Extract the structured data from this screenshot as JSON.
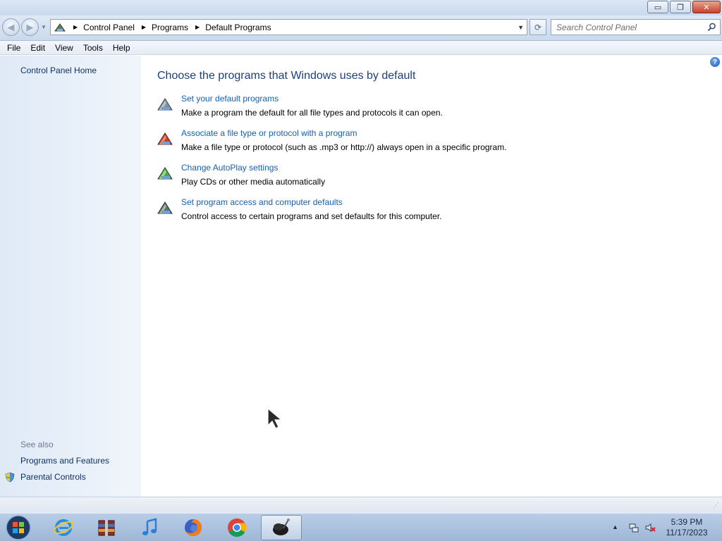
{
  "window": {
    "controls": {
      "minimize": "▭",
      "restore": "❐",
      "close": "✕"
    }
  },
  "nav": {
    "breadcrumbs": [
      "Control Panel",
      "Programs",
      "Default Programs"
    ],
    "search_placeholder": "Search Control Panel"
  },
  "menu": {
    "items": [
      "File",
      "Edit",
      "View",
      "Tools",
      "Help"
    ]
  },
  "sidebar": {
    "home": "Control Panel Home",
    "see_also": "See also",
    "links": [
      "Programs and Features",
      "Parental Controls"
    ]
  },
  "main": {
    "help": "?",
    "heading": "Choose the programs that Windows uses by default",
    "tasks": [
      {
        "link": "Set your default programs",
        "desc": "Make a program the default for all file types and protocols it can open.",
        "icon": "default-programs-icon"
      },
      {
        "link": "Associate a file type or protocol with a program",
        "desc": "Make a file type or protocol (such as .mp3 or http://) always open in a specific program.",
        "icon": "file-association-icon"
      },
      {
        "link": "Change AutoPlay settings",
        "desc": "Play CDs or other media automatically",
        "icon": "autoplay-icon"
      },
      {
        "link": "Set program access and computer defaults",
        "desc": "Control access to certain programs and set defaults for this computer.",
        "icon": "program-access-icon"
      }
    ]
  },
  "taskbar": {
    "apps": [
      "internet-explorer-icon",
      "archive-manager-icon",
      "itunes-icon",
      "firefox-icon",
      "chrome-icon",
      "app-icon"
    ],
    "time": "5:39 PM",
    "date": "11/17/2023"
  },
  "colors": {
    "link": "#1560b0",
    "heading": "#1e3f7a",
    "sidebar_link": "#0d2f5e"
  }
}
